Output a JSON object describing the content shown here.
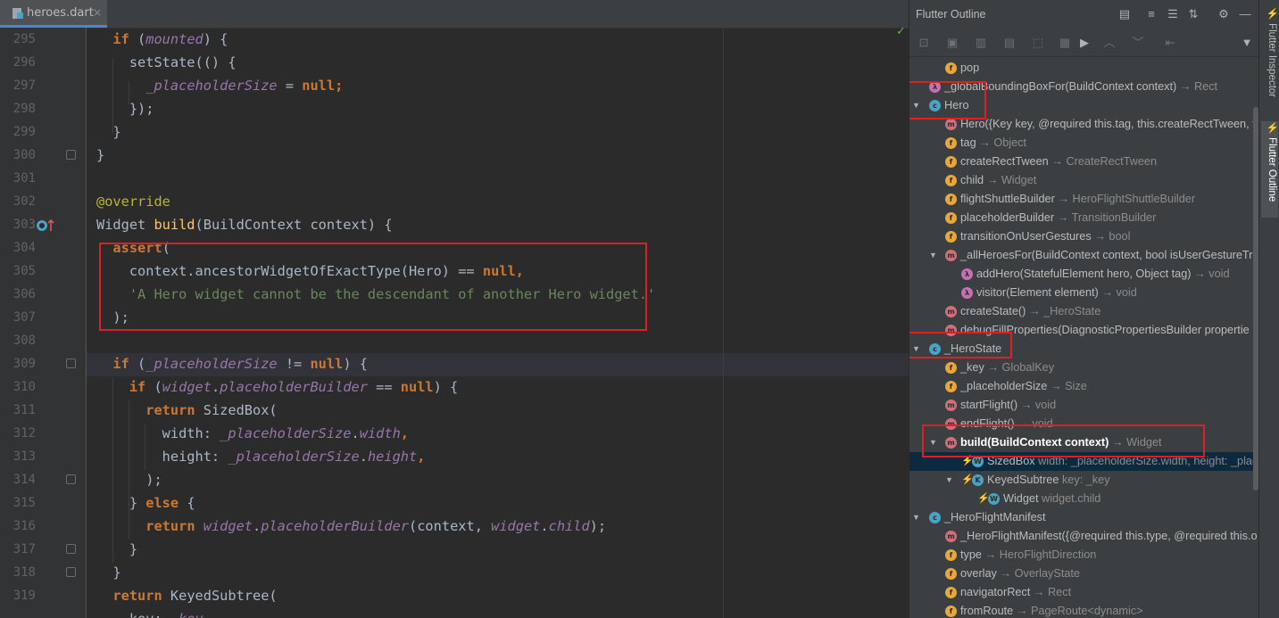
{
  "editor": {
    "tab_name": "heroes.dart",
    "tab_close": "×",
    "check_mark": "✓",
    "lines": [
      "295",
      "296",
      "297",
      "298",
      "299",
      "300",
      "301",
      "302",
      "303",
      "304",
      "305",
      "306",
      "307",
      "308",
      "309",
      "310",
      "311",
      "312",
      "313",
      "314",
      "315",
      "316",
      "317",
      "318",
      "319"
    ],
    "code": {
      "l295": [
        "if",
        " (",
        "mounted",
        ") {"
      ],
      "l296": [
        "  setState(() {"
      ],
      "l297": [
        "    ",
        "_placeholderSize",
        " = ",
        "null",
        ";"
      ],
      "l298": [
        "  });"
      ],
      "l299": [
        "}"
      ],
      "l300": [
        "}"
      ],
      "l301": [
        ""
      ],
      "l302": [
        "@override"
      ],
      "l303": [
        "Widget ",
        "build",
        "(BuildContext context) {"
      ],
      "l304": [
        "  ",
        "assert",
        "("
      ],
      "l305": [
        "    context.ancestorWidgetOfExactType(Hero) == ",
        "null",
        ","
      ],
      "l306": [
        "    ",
        "'A Hero widget cannot be the descendant of another Hero widget.'"
      ],
      "l307": [
        "  );"
      ],
      "l308": [
        ""
      ],
      "l309": [
        "  ",
        "if",
        " (",
        "_placeholderSize",
        " != ",
        "null",
        ") {"
      ],
      "l310": [
        "    ",
        "if",
        " (",
        "widget",
        ".",
        "placeholderBuilder",
        " == ",
        "null",
        ") {"
      ],
      "l311": [
        "      ",
        "return",
        " SizedBox("
      ],
      "l312": [
        "        width: ",
        "_placeholderSize",
        ".",
        "width",
        ","
      ],
      "l313": [
        "        height: ",
        "_placeholderSize",
        ".",
        "height",
        ","
      ],
      "l314": [
        "      );"
      ],
      "l315": [
        "    } ",
        "else",
        " {"
      ],
      "l316": [
        "      ",
        "return",
        " ",
        "widget",
        ".",
        "placeholderBuilder",
        "(context, ",
        "widget",
        ".",
        "child",
        ");"
      ],
      "l317": [
        "    }"
      ],
      "l318": [
        "  }"
      ],
      "l319": [
        "  ",
        "return",
        " KeyedSubtree("
      ],
      "l320": [
        "    key: ",
        "_key"
      ]
    }
  },
  "outline": {
    "title": "Flutter Outline",
    "items": [
      {
        "badge": "f",
        "name": "pop",
        "detail": ""
      },
      {
        "badge": "l",
        "name": "_globalBoundingBoxFor(BuildContext context)",
        "detail": " → Rect"
      },
      {
        "badge": "c",
        "name": "Hero",
        "detail": ""
      },
      {
        "badge": "m",
        "name": "Hero({Key key, @required this.tag, this.createRectTween, this.",
        "detail": ""
      },
      {
        "badge": "f",
        "name": "tag",
        "detail": " → Object"
      },
      {
        "badge": "f",
        "name": "createRectTween",
        "detail": " → CreateRectTween"
      },
      {
        "badge": "f",
        "name": "child",
        "detail": " → Widget"
      },
      {
        "badge": "f",
        "name": "flightShuttleBuilder",
        "detail": " → HeroFlightShuttleBuilder"
      },
      {
        "badge": "f",
        "name": "placeholderBuilder",
        "detail": " → TransitionBuilder"
      },
      {
        "badge": "f",
        "name": "transitionOnUserGestures",
        "detail": " → bool"
      },
      {
        "badge": "m",
        "name": "_allHeroesFor(BuildContext context, bool isUserGestureTra",
        "detail": ""
      },
      {
        "badge": "l",
        "name": "addHero(StatefulElement hero, Object tag)",
        "detail": " → void"
      },
      {
        "badge": "l",
        "name": "visitor(Element element)",
        "detail": " → void"
      },
      {
        "badge": "m",
        "name": "createState()",
        "detail": " → _HeroState"
      },
      {
        "badge": "m",
        "name": "debugFillProperties(DiagnosticPropertiesBuilder propertie",
        "detail": ""
      },
      {
        "badge": "c",
        "name": "_HeroState",
        "detail": ""
      },
      {
        "badge": "f",
        "name": "_key",
        "detail": " → GlobalKey"
      },
      {
        "badge": "f",
        "name": "_placeholderSize",
        "detail": " → Size"
      },
      {
        "badge": "m",
        "name": "startFlight()",
        "detail": " → void"
      },
      {
        "badge": "m",
        "name": "endFlight()",
        "detail": " → void"
      },
      {
        "badge": "m",
        "name": "build(BuildContext context)",
        "detail": " → Widget"
      },
      {
        "badge": "w",
        "name": "SizedBox",
        "detail": " width: _placeholderSize.width, height: _plac"
      },
      {
        "badge": "k",
        "name": "KeyedSubtree",
        "detail": " key: _key"
      },
      {
        "badge": "w",
        "name": "Widget",
        "detail": " widget.child"
      },
      {
        "badge": "c",
        "name": "_HeroFlightManifest",
        "detail": ""
      },
      {
        "badge": "m",
        "name": "_HeroFlightManifest({@required this.type, @required this.o",
        "detail": ""
      },
      {
        "badge": "f",
        "name": "type",
        "detail": " → HeroFlightDirection"
      },
      {
        "badge": "f",
        "name": "overlay",
        "detail": " → OverlayState"
      },
      {
        "badge": "f",
        "name": "navigatorRect",
        "detail": " → Rect"
      },
      {
        "badge": "f",
        "name": "fromRoute",
        "detail": " → PageRoute<dynamic>"
      }
    ]
  },
  "strip": {
    "inspector": "Flutter Inspector",
    "outline": "Flutter Outline"
  },
  "colors": {
    "accent": "#4a88c7",
    "highlight": "#e02020",
    "keyword": "#cc7832",
    "field": "#9876aa",
    "string": "#6a8759"
  }
}
